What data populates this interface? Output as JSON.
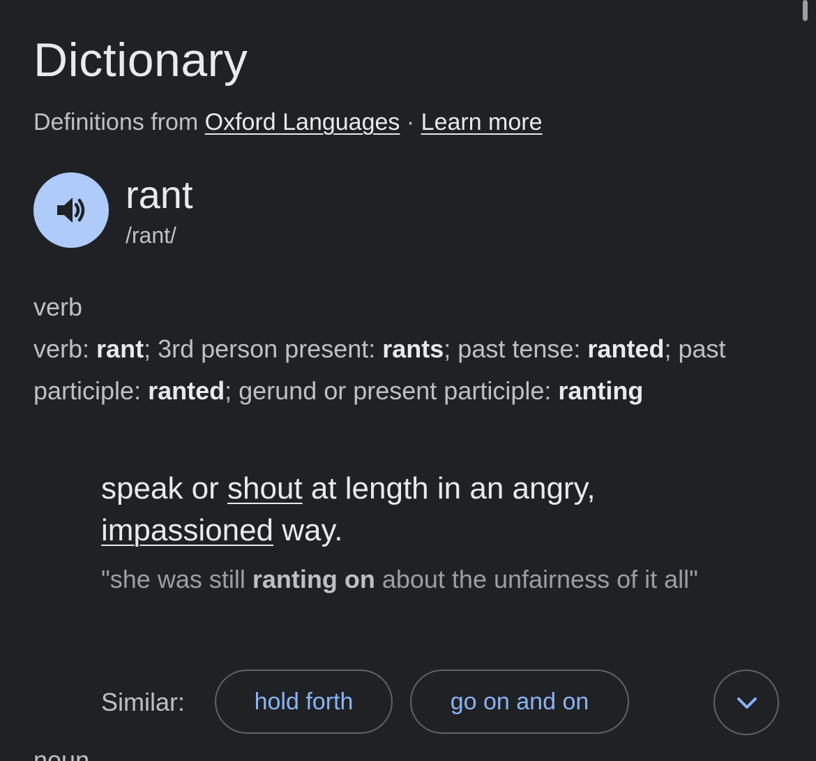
{
  "header": {
    "title": "Dictionary",
    "source_prefix": "Definitions from",
    "source_link": "Oxford Languages",
    "separator": "·",
    "learn_more": "Learn more"
  },
  "entry": {
    "word": "rant",
    "phonetic": "/rant/",
    "audio_icon": "speaker-icon",
    "part_of_speech": "verb",
    "forms": [
      {
        "label": "verb: ",
        "value": "rant"
      },
      {
        "label": "; 3rd person present: ",
        "value": "rants"
      },
      {
        "label": "; past tense: ",
        "value": "ranted"
      },
      {
        "label": "; past participle: ",
        "value": "ranted"
      },
      {
        "label": "; gerund or present participle: ",
        "value": "ranting"
      }
    ],
    "definition": {
      "part1": "speak or ",
      "link1": "shout",
      "part2": " at length in an angry, ",
      "link2": "impassioned",
      "part3": " way."
    },
    "example": {
      "part1": "\"she was still ",
      "bold": "ranting on",
      "part2": " about the unfairness of it all\""
    },
    "similar": {
      "label": "Similar:",
      "chips": [
        "hold forth",
        "go on and on"
      ],
      "expand_icon": "chevron-down-icon"
    },
    "next_part_of_speech": "noun"
  },
  "colors": {
    "background": "#202124",
    "text_primary": "#e8eaed",
    "text_secondary": "#bdc1c6",
    "link_blue": "#8ab4f8",
    "audio_button": "#aecbfa",
    "chip_border": "#5f6368"
  }
}
